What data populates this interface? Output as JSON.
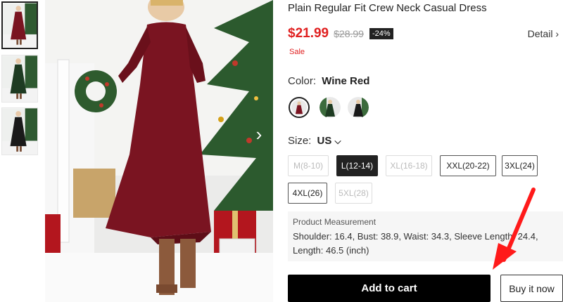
{
  "product": {
    "title": "Plain Regular Fit Crew Neck Casual Dress",
    "price": "$21.99",
    "original_price": "$28.99",
    "discount": "-24%",
    "sale_tag": "Sale",
    "detail_link": "Detail",
    "detail_icon": "chevron-right-icon"
  },
  "color": {
    "label": "Color:",
    "selected": "Wine Red",
    "swatches": [
      {
        "name": "Wine Red",
        "hex": "#7a1421",
        "active": true
      },
      {
        "name": "Dark Green",
        "hex": "#1e3b22",
        "active": false
      },
      {
        "name": "Black",
        "hex": "#1a1a1a",
        "active": false
      }
    ]
  },
  "size": {
    "label": "Size:",
    "region": "US",
    "region_icon": "chevron-down-icon",
    "options": [
      {
        "label": "M(8-10)",
        "state": "disabled"
      },
      {
        "label": "L(12-14)",
        "state": "selected"
      },
      {
        "label": "XL(16-18)",
        "state": "disabled"
      },
      {
        "label": "XXL(20-22)",
        "state": "available"
      },
      {
        "label": "3XL(24)",
        "state": "available"
      },
      {
        "label": "4XL(26)",
        "state": "available"
      },
      {
        "label": "5XL(28)",
        "state": "disabled"
      }
    ]
  },
  "measurement": {
    "title": "Product Measurement",
    "line1": "Shoulder: 16.4, Bust: 38.9, Waist: 34.3, Sleeve Length: 24.4,",
    "line2": "Length: 46.5 (inch)"
  },
  "actions": {
    "add_to_cart": "Add to cart",
    "buy_now": "Buy it now"
  },
  "gallery": {
    "next_icon": "chevron-right-icon",
    "thumbnails": [
      {
        "color": "#7a1421",
        "active": true
      },
      {
        "color": "#1e3b22",
        "active": false
      },
      {
        "color": "#1a1a1a",
        "active": false
      }
    ]
  },
  "annotation": {
    "arrow_color": "#ff1a1a"
  }
}
